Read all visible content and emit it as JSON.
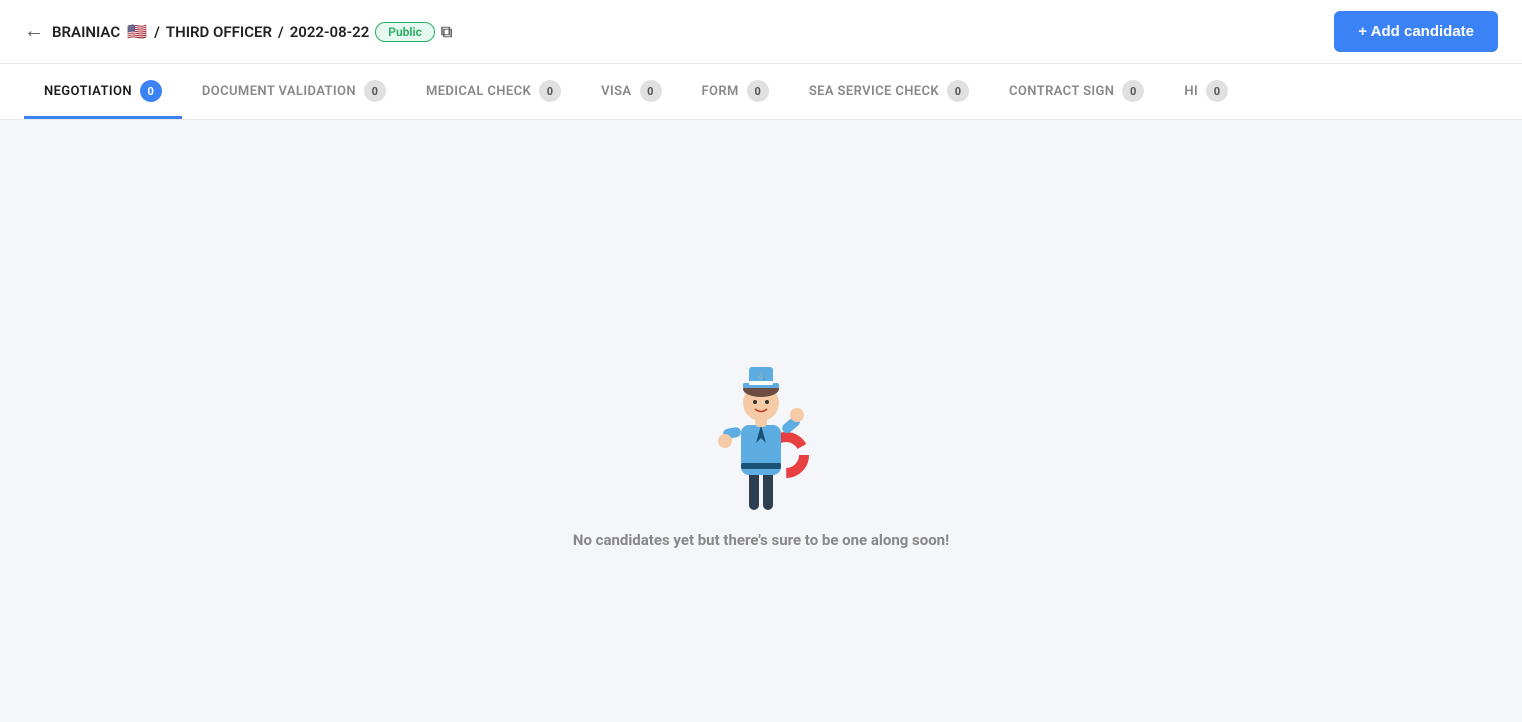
{
  "header": {
    "back_label": "←",
    "company": "BRAINIAC",
    "position": "THIRD OFFICER",
    "date": "2022-08-22",
    "status": "Public",
    "add_candidate_label": "+ Add candidate",
    "external_link_symbol": "⧉"
  },
  "tabs": [
    {
      "id": "negotiation",
      "label": "NEGOTIATION",
      "count": 0,
      "active": true
    },
    {
      "id": "document-validation",
      "label": "DOCUMENT VALIDATION",
      "count": 0,
      "active": false
    },
    {
      "id": "medical-check",
      "label": "MEDICAL CHECK",
      "count": 0,
      "active": false
    },
    {
      "id": "visa",
      "label": "VISA",
      "count": 0,
      "active": false
    },
    {
      "id": "form",
      "label": "FORM",
      "count": 0,
      "active": false
    },
    {
      "id": "sea-service-check",
      "label": "SEA SERVICE CHECK",
      "count": 0,
      "active": false
    },
    {
      "id": "contract-sign",
      "label": "CONTRACT SIGN",
      "count": 0,
      "active": false
    },
    {
      "id": "hi",
      "label": "HI",
      "count": 0,
      "active": false
    }
  ],
  "empty_state": {
    "message": "No candidates yet but there's sure to be one along soon!"
  }
}
